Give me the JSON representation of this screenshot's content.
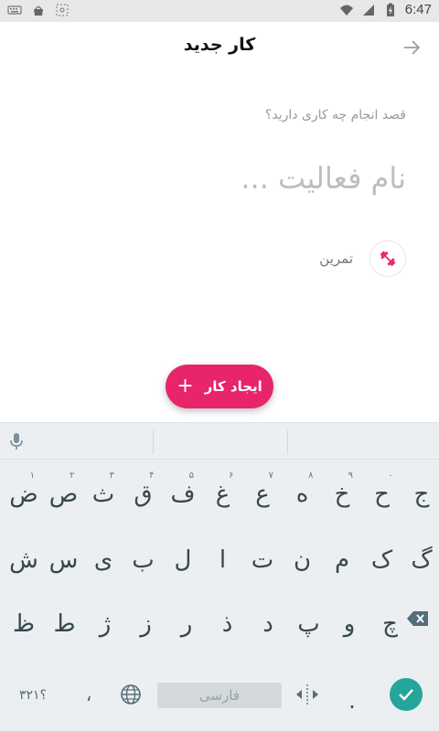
{
  "status_bar": {
    "time": "6:47",
    "left_icons": [
      "keyboard-icon",
      "basket-icon",
      "screenshot-icon"
    ],
    "right_icons": [
      "wifi-icon",
      "signal-icon",
      "battery-icon"
    ]
  },
  "appbar": {
    "title": "کار جدید",
    "back_icon": "arrow-forward-icon"
  },
  "form": {
    "question": "قصد انجام چه کاری دارید؟",
    "name_placeholder": "نام فعالیت ...",
    "name_value": "",
    "category": {
      "label": "تمرین",
      "icon": "dumbbell-icon",
      "color": "#e8246a"
    }
  },
  "fab": {
    "label": "ایجاد کار",
    "icon": "plus-icon",
    "color": "#e8246a"
  },
  "keyboard": {
    "row1": [
      {
        "ch": "ض",
        "hint": "۱"
      },
      {
        "ch": "ص",
        "hint": "۲"
      },
      {
        "ch": "ث",
        "hint": "۳"
      },
      {
        "ch": "ق",
        "hint": "۴"
      },
      {
        "ch": "ف",
        "hint": "۵"
      },
      {
        "ch": "غ",
        "hint": "۶"
      },
      {
        "ch": "ع",
        "hint": "۷"
      },
      {
        "ch": "ه",
        "hint": "۸"
      },
      {
        "ch": "خ",
        "hint": "۹"
      },
      {
        "ch": "ح",
        "hint": "۰"
      },
      {
        "ch": "ج",
        "hint": ""
      }
    ],
    "row2": [
      "ش",
      "س",
      "ی",
      "ب",
      "ل",
      "ا",
      "ت",
      "ن",
      "م",
      "ک",
      "گ"
    ],
    "row3": [
      "ظ",
      "ط",
      "ژ",
      "ز",
      "ر",
      "ذ",
      "د",
      "پ",
      "و",
      "چ"
    ],
    "symbols_label": "؟۳۲۱",
    "comma_label": "،",
    "space_label": "فارسی",
    "period_label": ".",
    "enter_color": "#26a69a"
  }
}
